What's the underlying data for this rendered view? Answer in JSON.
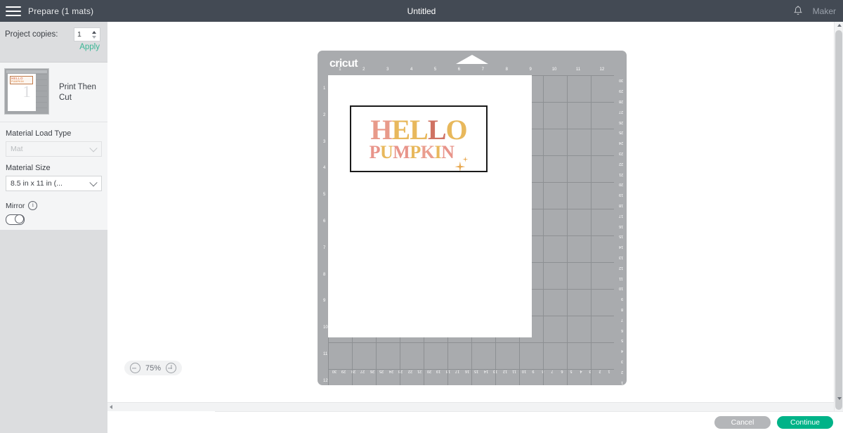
{
  "header": {
    "menu_icon": "hamburger-icon",
    "title": "Prepare (1 mats)",
    "project_name": "Untitled",
    "bell_icon": "bell-icon",
    "machine": "Maker"
  },
  "sidebar": {
    "copies": {
      "label": "Project copies:",
      "value": "1",
      "apply_label": "Apply"
    },
    "mat": {
      "card_label": "Print Then Cut",
      "thumb_number": "1",
      "thumb_line1": "HELLO",
      "thumb_line2": "PUMPKIN"
    },
    "material_load_type": {
      "label": "Material Load Type",
      "value": "Mat",
      "chevron_icon": "chevron-down-icon",
      "disabled": true
    },
    "material_size": {
      "label": "Material Size",
      "value": "8.5 in x 11 in (...",
      "chevron_icon": "chevron-down-icon"
    },
    "mirror": {
      "label": "Mirror",
      "info_icon": "info-icon",
      "info_glyph": "i",
      "toggle_state": "off"
    }
  },
  "canvas": {
    "mat": {
      "brand": "cricut",
      "ruler_top": [
        "1",
        "2",
        "3",
        "4",
        "5",
        "6",
        "7",
        "8",
        "9",
        "10",
        "11",
        "12"
      ],
      "ruler_left": [
        "1",
        "2",
        "3",
        "4",
        "5",
        "6",
        "7",
        "8",
        "9",
        "10",
        "11",
        "12"
      ],
      "ruler_right": [
        "30",
        "29",
        "28",
        "27",
        "26",
        "25",
        "24",
        "23",
        "22",
        "21",
        "20",
        "19",
        "18",
        "17",
        "16",
        "15",
        "14",
        "13",
        "12",
        "11",
        "10",
        "9",
        "8",
        "7",
        "6",
        "5",
        "4",
        "3",
        "2",
        "1"
      ],
      "ruler_bottom": [
        "30",
        "29",
        "28",
        "27",
        "26",
        "25",
        "24",
        "23",
        "22",
        "21",
        "20",
        "19",
        "18",
        "17",
        "16",
        "15",
        "14",
        "13",
        "12",
        "11",
        "10",
        "9",
        "8",
        "7",
        "6",
        "5",
        "4",
        "3",
        "2",
        "1"
      ]
    },
    "design": {
      "line1": "HELLO",
      "line2": "PUMPKIN",
      "sparkle_icon": "sparkle-icon",
      "letter_colors_line1": [
        "#e89a8a",
        "#e8b85c",
        "#e8b85c",
        "#cf7263",
        "#e8b85c",
        "#f0a88f"
      ],
      "letter_colors_line2": [
        "#e8948a",
        "#e8b85c",
        "#e8948a",
        "#e8b85c",
        "#ea9d8e",
        "#e8b85c",
        "#e8948a",
        "#cf7263"
      ],
      "sparkle_color": "#e8a84f"
    },
    "zoom": {
      "minus_icon": "zoom-out-icon",
      "plus_icon": "zoom-in-icon",
      "percent": "75%"
    }
  },
  "footer": {
    "cancel_label": "Cancel",
    "continue_label": "Continue",
    "continue_color": "#00b388"
  }
}
